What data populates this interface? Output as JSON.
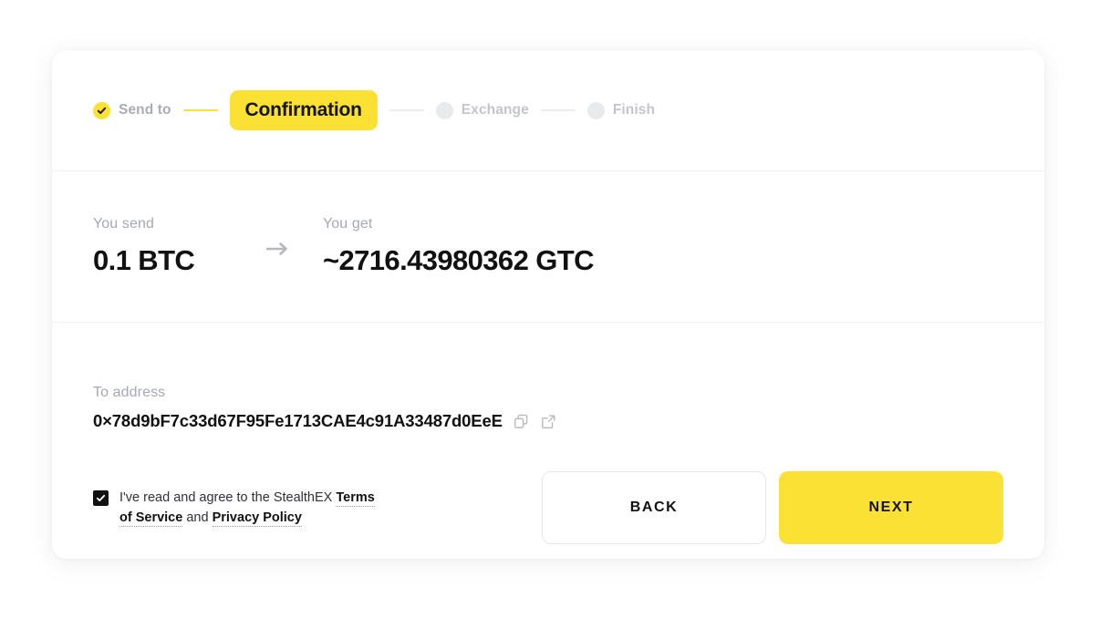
{
  "steps": [
    {
      "label": "Send to",
      "state": "done",
      "icon": "check-circle-icon"
    },
    {
      "label": "Confirmation",
      "state": "current"
    },
    {
      "label": "Exchange",
      "state": "todo"
    },
    {
      "label": "Finish",
      "state": "todo"
    }
  ],
  "exchange": {
    "send_label": "You send",
    "send_value": "0.1 BTC",
    "arrow_icon": "arrow-right-icon",
    "get_label": "You get",
    "get_value": "~2716.43980362 GTC"
  },
  "address": {
    "label": "To address",
    "value": "0×78d9bF7c33d67F95Fe1713CAE4c91A33487d0EeE",
    "copy_icon": "copy-icon",
    "external_icon": "external-link-icon"
  },
  "terms": {
    "checked": true,
    "text_before": "I've read and agree to the StealthEX",
    "terms_link": "Terms of Service",
    "conjunction": "and",
    "privacy_link": "Privacy Policy"
  },
  "actions": {
    "back_label": "BACK",
    "next_label": "NEXT"
  },
  "colors": {
    "accent_yellow": "#FBE134",
    "text_dark": "#111111",
    "text_muted": "#a6a9af",
    "divider": "#f1f1f3"
  }
}
